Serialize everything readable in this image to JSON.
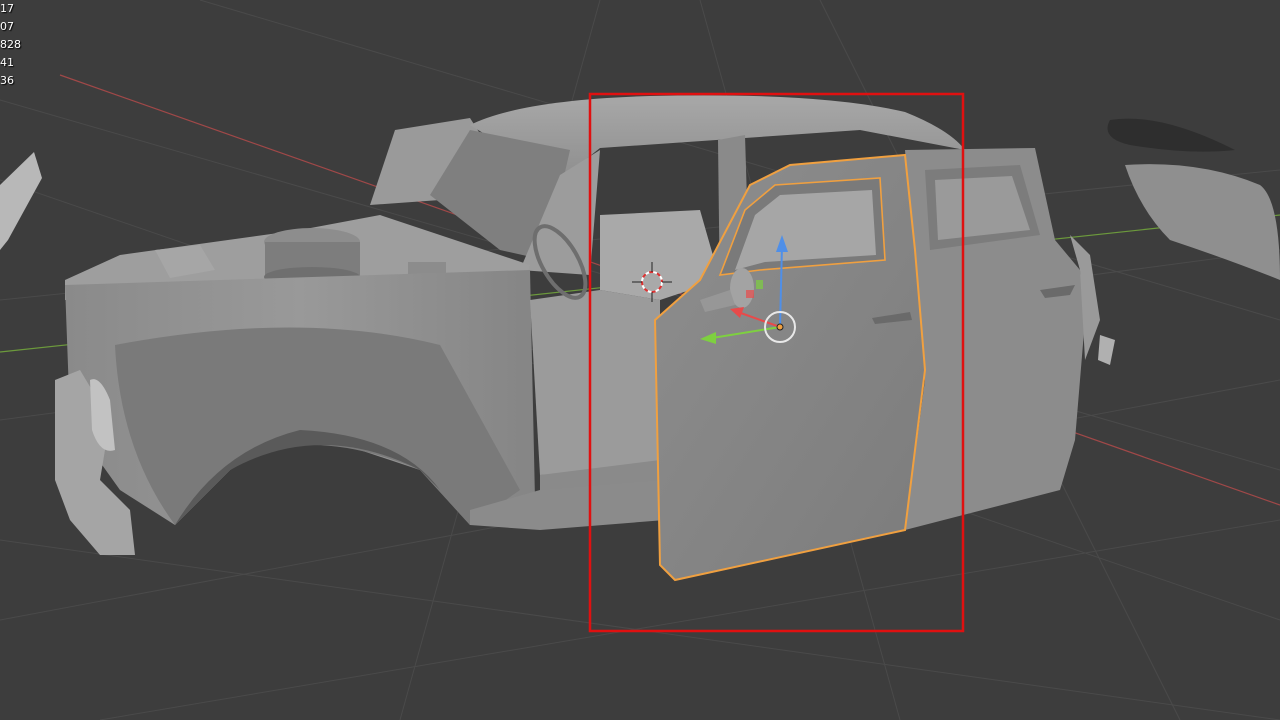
{
  "viewport": {
    "stats": [
      "17",
      "07",
      "828",
      "41",
      "36"
    ]
  },
  "colors": {
    "background": "#3d3d3d",
    "grid_line": "#4a4a4a",
    "x_axis": "#a04848",
    "y_axis": "#6c9a3c",
    "model_gray": "#8d8d8d",
    "selection_outline": "#f0a040",
    "box_select": "#e01010",
    "gizmo_z": "#4f8fe8",
    "gizmo_y": "#7ed040",
    "gizmo_x": "#e84a4a"
  },
  "icons": {
    "cursor": "3d-cursor-icon",
    "pivot": "object-origin-icon"
  }
}
